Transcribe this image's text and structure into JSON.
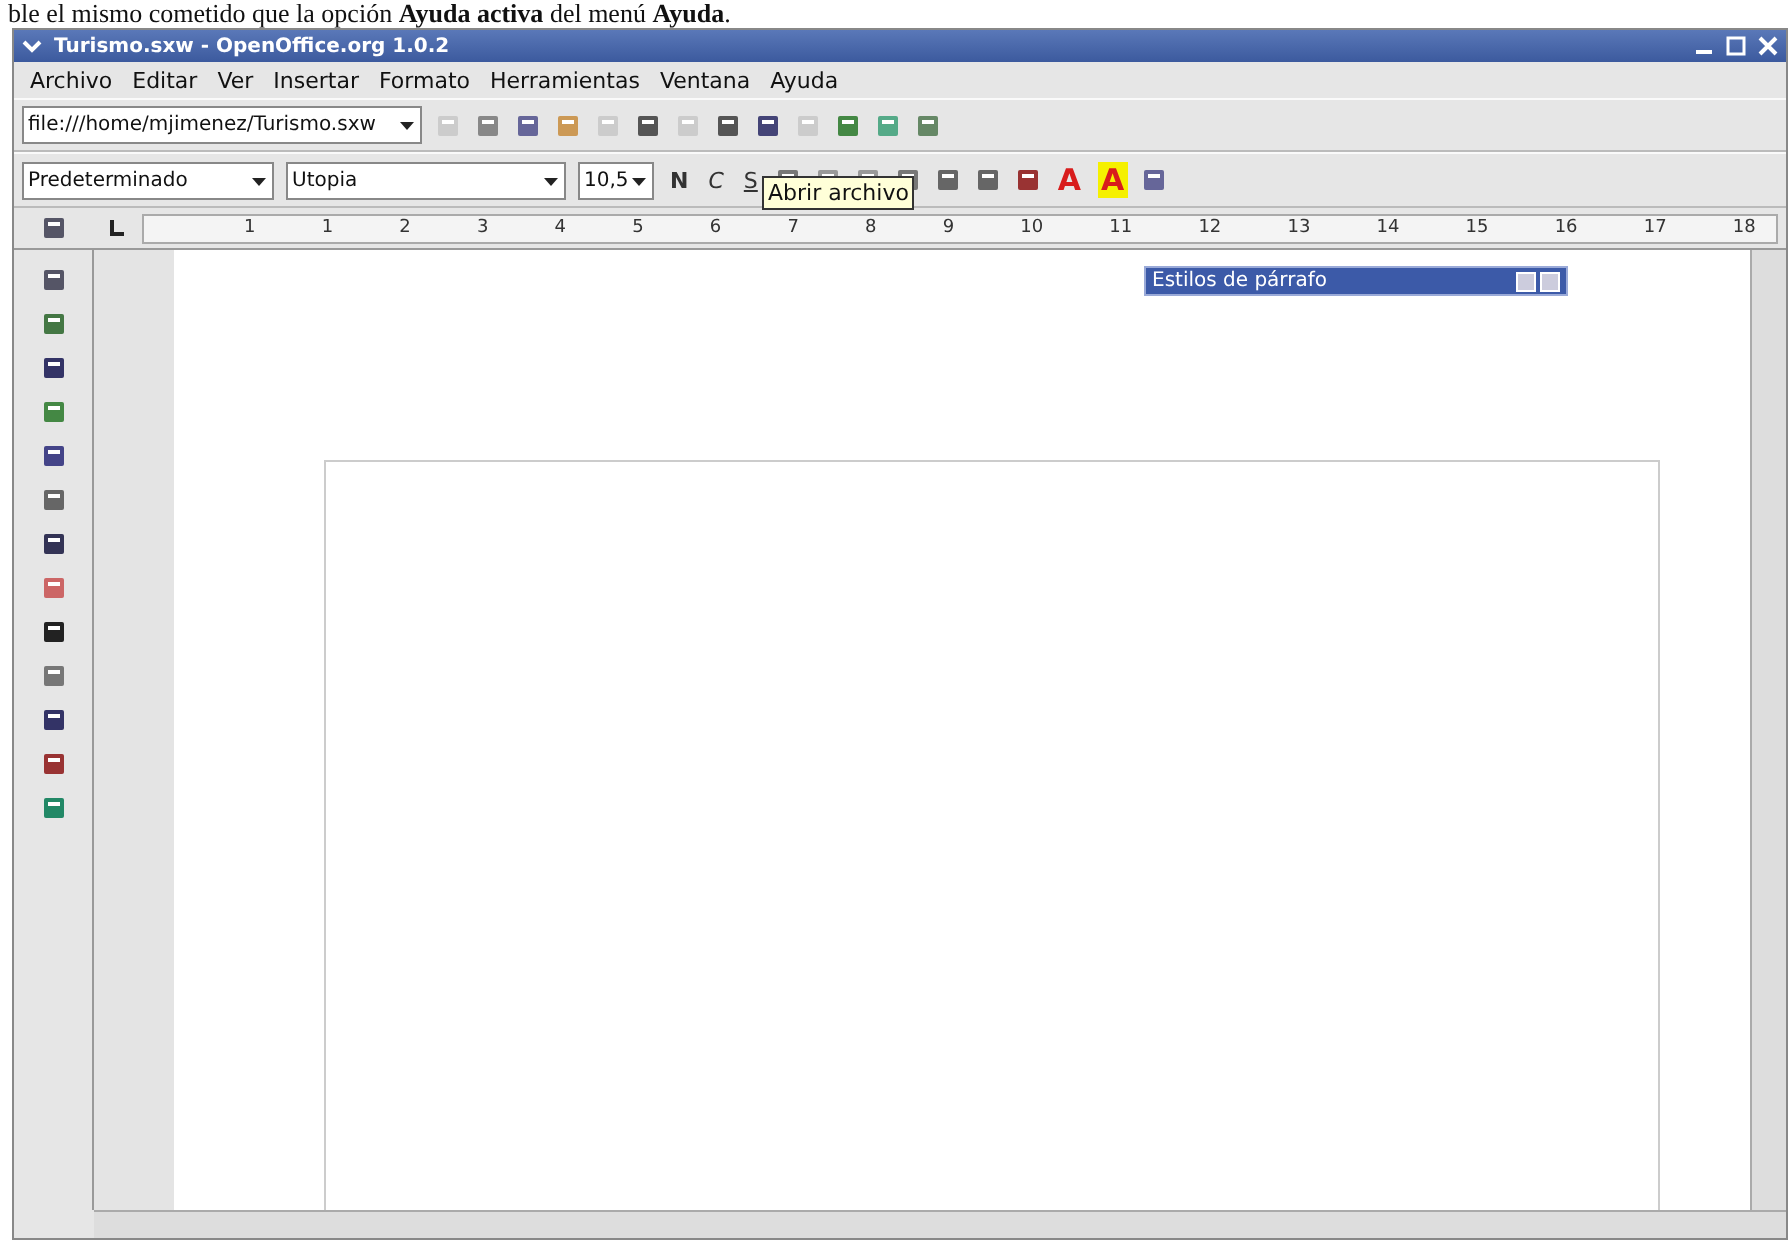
{
  "caption": "ble el mismo cometido que la opción **Ayuda activa** del menú **Ayuda**.",
  "window": {
    "title": "Turismo.sxw - OpenOffice.org 1.0.2"
  },
  "menu": [
    {
      "label": "Archivo"
    },
    {
      "label": "Editar"
    },
    {
      "label": "Ver"
    },
    {
      "label": "Insertar"
    },
    {
      "label": "Formato"
    },
    {
      "label": "Herramientas"
    },
    {
      "label": "Ventana"
    },
    {
      "label": "Ayuda"
    }
  ],
  "toolbar": {
    "url": "file:///home/mjimenez/Turismo.sxw"
  },
  "format_bar": {
    "style": "Predeterminado",
    "font": "Utopia",
    "size": "10,5",
    "text_buttons": [
      {
        "label": "N",
        "kind": "bold"
      },
      {
        "label": "C",
        "kind": "italic"
      },
      {
        "label": "S",
        "kind": "underline"
      }
    ],
    "color_buttons": [
      {
        "label": "A",
        "kind": "font_color",
        "color": "#d81c1c"
      },
      {
        "label": "A",
        "kind": "highlight",
        "color": "#f5f000"
      }
    ]
  },
  "tooltip": "Abrir archivo",
  "ruler": [
    "1",
    "1",
    "2",
    "3",
    "4",
    "5",
    "6",
    "7",
    "8",
    "9",
    "10",
    "11",
    "12",
    "13",
    "14",
    "15",
    "16",
    "17",
    "18"
  ],
  "styles_panel": {
    "title": "Estilos de párrafo"
  }
}
